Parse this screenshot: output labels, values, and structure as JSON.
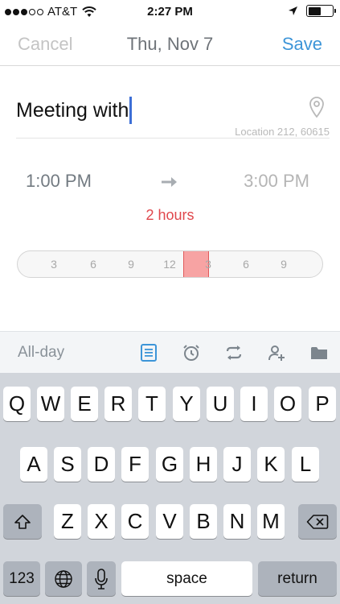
{
  "status_bar": {
    "carrier": "AT&T",
    "time": "2:27 PM",
    "signal_icon": "signal-dots-icon",
    "wifi_icon": "wifi-icon",
    "location_icon": "location-arrow-icon",
    "battery_icon": "battery-icon",
    "battery_level": 0.55
  },
  "nav": {
    "cancel_label": "Cancel",
    "title": "Thu, Nov 7",
    "save_label": "Save"
  },
  "event": {
    "title_value": "Meeting with",
    "location_icon": "map-pin-icon",
    "location_hint": "Location 212, 60615"
  },
  "time": {
    "start": "1:00 PM",
    "end": "3:00 PM",
    "duration": "2 hours",
    "arrow_icon": "right-arrow-icon"
  },
  "timeline": {
    "ticks": [
      "3",
      "6",
      "9",
      "12",
      "3",
      "6",
      "9"
    ],
    "selected_start_hour": 13,
    "selected_end_hour": 15
  },
  "toolbar": {
    "allday_label": "All-day",
    "icons": [
      "notes-icon",
      "alarm-icon",
      "repeat-icon",
      "add-person-icon",
      "folder-icon"
    ]
  },
  "keyboard": {
    "row1": [
      "Q",
      "W",
      "E",
      "R",
      "T",
      "Y",
      "U",
      "I",
      "O",
      "P"
    ],
    "row2": [
      "A",
      "S",
      "D",
      "F",
      "G",
      "H",
      "J",
      "K",
      "L"
    ],
    "row3": [
      "Z",
      "X",
      "C",
      "V",
      "B",
      "N",
      "M"
    ],
    "numbers_label": "123",
    "space_label": "space",
    "return_label": "return",
    "shift_icon": "shift-icon",
    "delete_icon": "backspace-icon",
    "globe_icon": "globe-icon",
    "mic_icon": "microphone-icon"
  },
  "colors": {
    "accent": "#3d95d8",
    "duration": "#e0474c",
    "selection": "#f7a3a3"
  }
}
